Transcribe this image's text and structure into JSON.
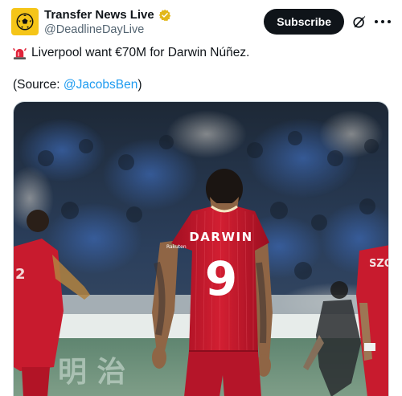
{
  "tweet": {
    "author_name": "Transfer News Live",
    "author_handle": "@DeadlineDayLive",
    "subscribe_label": "Subscribe",
    "line1_emoji": "siren-icon",
    "line1_text": "Liverpool want €70M for Darwin Núñez.",
    "source_prefix": "(Source: ",
    "source_mention": "@JacobsBen",
    "source_suffix": ")"
  },
  "media": {
    "description_icon": "photo",
    "jersey_name": "DARWIN",
    "jersey_number": "9",
    "jersey_sponsor": "Rakuten",
    "left_player_jersey_text": "SZO",
    "banner_text": "明 治"
  },
  "colors": {
    "accent": "#1d9bf0",
    "verified_gold": "#e2b719",
    "liverpool_red": "#c8102e",
    "avatar_yellow": "#f5c518"
  }
}
